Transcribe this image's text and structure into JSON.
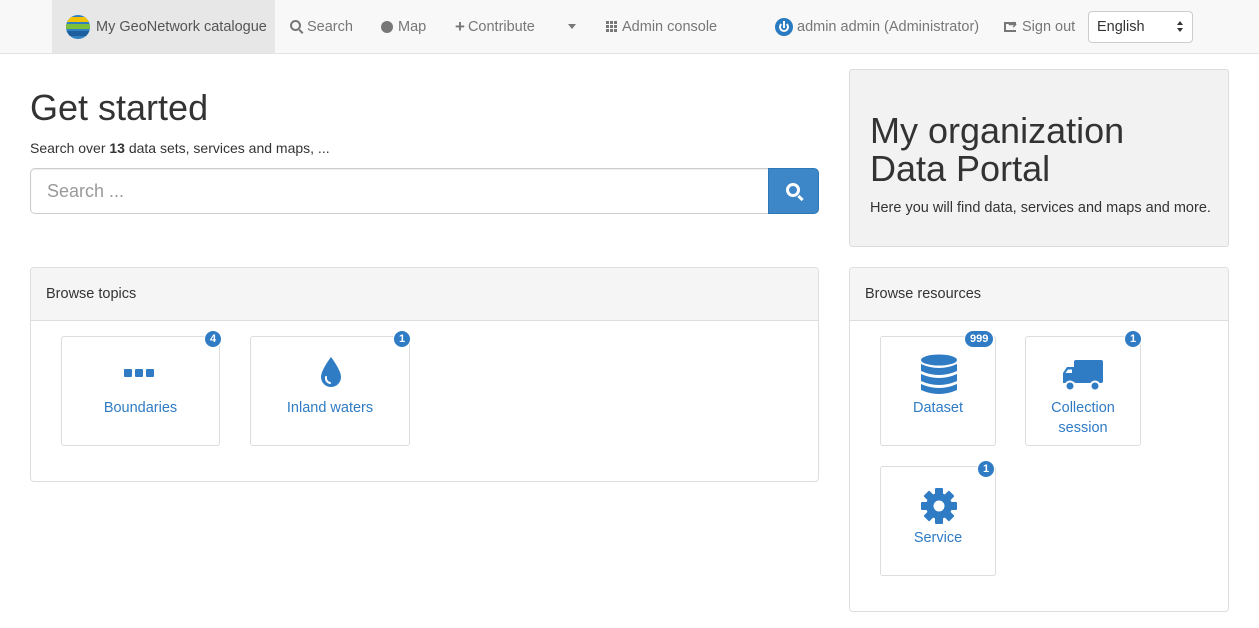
{
  "nav": {
    "brand": "My GeoNetwork catalogue",
    "search": "Search",
    "map": "Map",
    "contribute": "Contribute",
    "admin_console": "Admin console",
    "user": "admin admin (Administrator)",
    "sign_out": "Sign out",
    "language": "English"
  },
  "hero": {
    "title": "Get started",
    "sub_prefix": "Search over",
    "count": "13",
    "sub_suffix": "data sets, services and maps, ...",
    "search_placeholder": "Search ..."
  },
  "jumbo": {
    "title": "My organization Data Portal",
    "text": "Here you will find data, services and maps and more."
  },
  "topics": {
    "heading": "Browse topics",
    "items": [
      {
        "label": "Boundaries",
        "count": "4",
        "icon": "dots-icon"
      },
      {
        "label": "Inland waters",
        "count": "1",
        "icon": "droplet-icon"
      }
    ]
  },
  "resources": {
    "heading": "Browse resources",
    "items": [
      {
        "label": "Dataset",
        "count": "999",
        "icon": "database-icon"
      },
      {
        "label": "Collection session",
        "count": "1",
        "icon": "truck-icon"
      },
      {
        "label": "Service",
        "count": "1",
        "icon": "cog-icon"
      }
    ]
  },
  "colors": {
    "accent": "#2f7bc4",
    "button": "#3d87c8",
    "navbar": "#f8f8f8"
  }
}
